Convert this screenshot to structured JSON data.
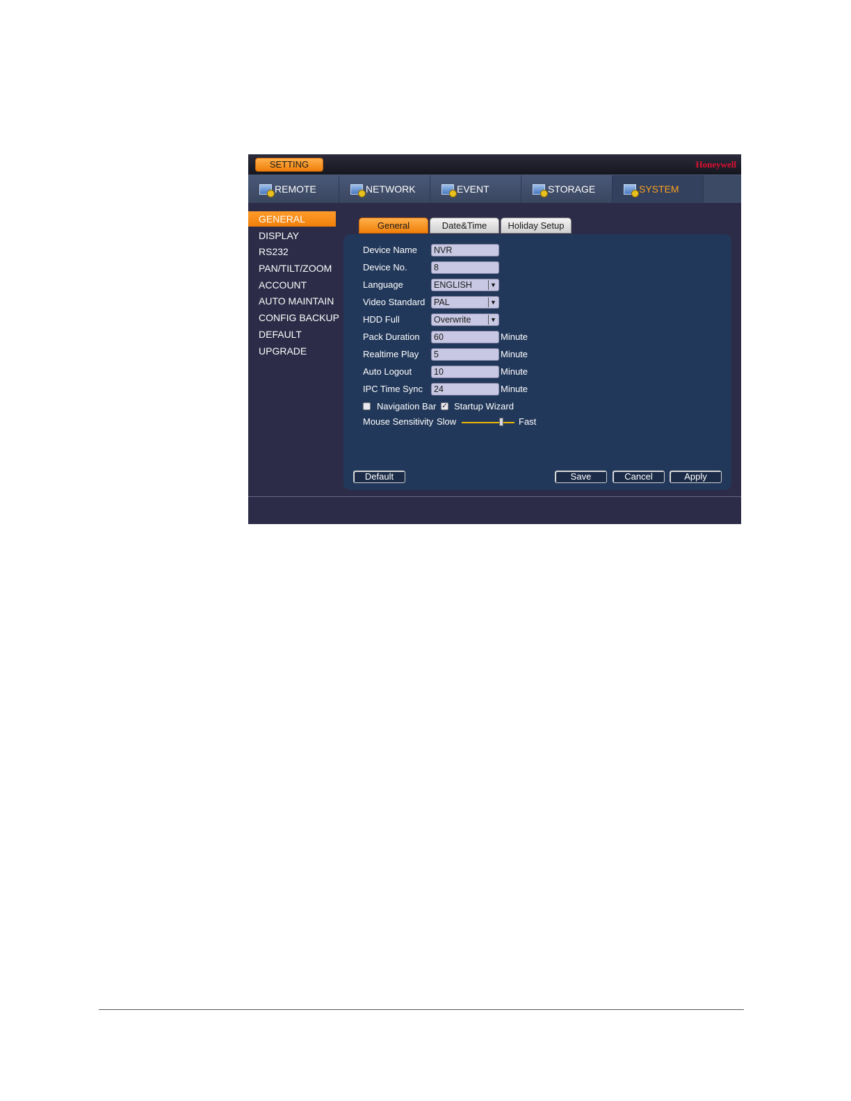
{
  "window": {
    "title": "SETTING",
    "brand": "Honeywell"
  },
  "topnav": [
    {
      "label": "REMOTE",
      "icon": "remote-icon"
    },
    {
      "label": "NETWORK",
      "icon": "network-icon"
    },
    {
      "label": "EVENT",
      "icon": "event-icon"
    },
    {
      "label": "STORAGE",
      "icon": "storage-icon"
    },
    {
      "label": "SYSTEM",
      "icon": "system-icon",
      "active": true
    }
  ],
  "sidebar": {
    "items": [
      "GENERAL",
      "DISPLAY",
      "RS232",
      "PAN/TILT/ZOOM",
      "ACCOUNT",
      "AUTO MAINTAIN",
      "CONFIG BACKUP",
      "DEFAULT",
      "UPGRADE"
    ],
    "active": "GENERAL"
  },
  "subtabs": {
    "items": [
      "General",
      "Date&Time",
      "Holiday Setup"
    ],
    "active": "General"
  },
  "form": {
    "device_name": {
      "label": "Device Name",
      "value": "NVR"
    },
    "device_no": {
      "label": "Device No.",
      "value": "8"
    },
    "language": {
      "label": "Language",
      "value": "ENGLISH"
    },
    "video_standard": {
      "label": "Video Standard",
      "value": "PAL"
    },
    "hdd_full": {
      "label": "HDD Full",
      "value": "Overwrite"
    },
    "pack_duration": {
      "label": "Pack Duration",
      "value": "60",
      "unit": "Minute"
    },
    "realtime_play": {
      "label": "Realtime Play",
      "value": "5",
      "unit": "Minute"
    },
    "auto_logout": {
      "label": "Auto Logout",
      "value": "10",
      "unit": "Minute"
    },
    "ipc_time_sync": {
      "label": "IPC Time Sync",
      "value": "24",
      "unit": "Minute"
    },
    "navigation_bar": {
      "label": "Navigation Bar",
      "checked": false
    },
    "startup_wizard": {
      "label": "Startup Wizard",
      "checked": true
    },
    "mouse_sensitivity": {
      "label": "Mouse Sensitivity",
      "min_label": "Slow",
      "max_label": "Fast",
      "level": 0.75
    }
  },
  "buttons": {
    "default": "Default",
    "save": "Save",
    "cancel": "Cancel",
    "apply": "Apply"
  },
  "colors": {
    "accent": "#f59a23",
    "brand": "#e01030",
    "panel": "#22385a",
    "background": "#2c2c48"
  }
}
